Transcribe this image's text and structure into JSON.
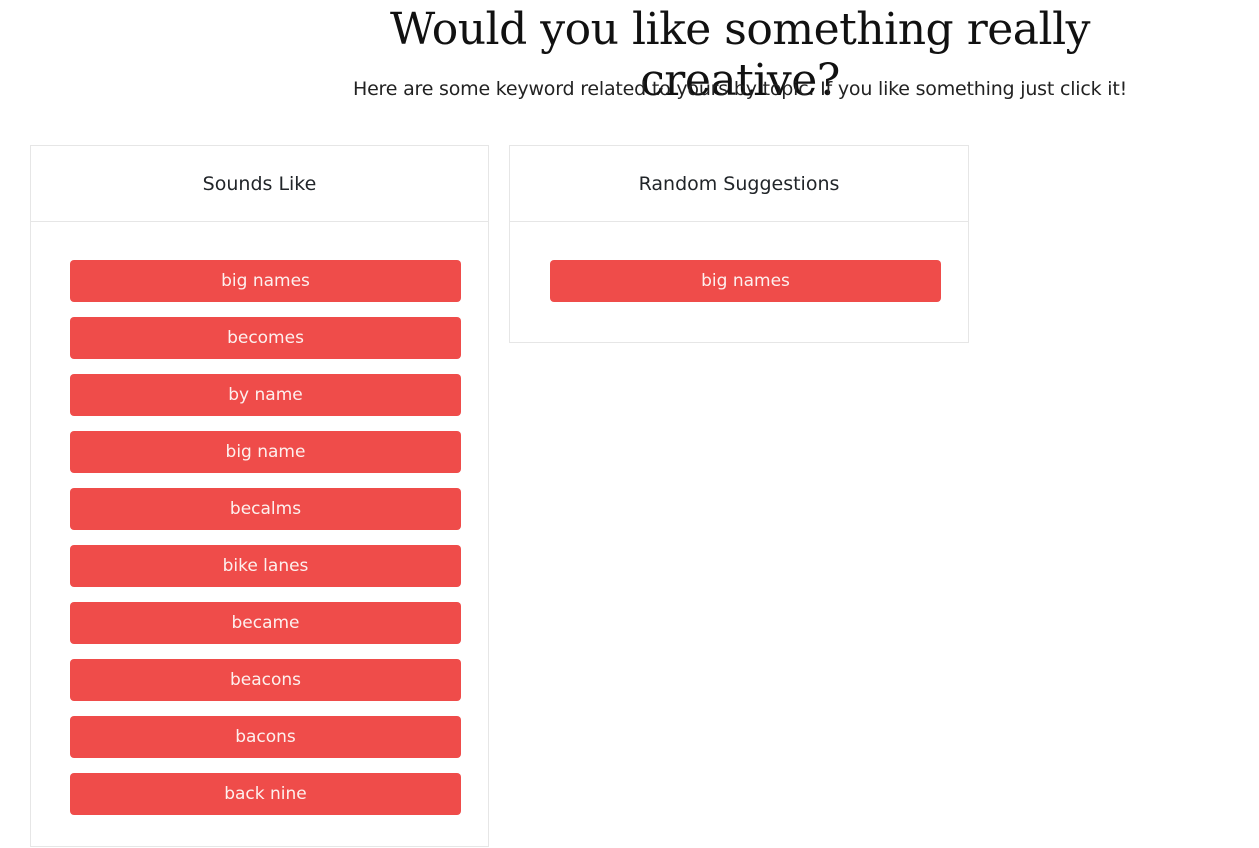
{
  "header": {
    "title": "Would you like something really creative?",
    "subtitle": "Here are some keyword related to yours by topic. If you like something just click it!"
  },
  "colors": {
    "button_bg": "#ef4c4a",
    "button_text": "#fdf0ee",
    "card_border": "#e6e6e6"
  },
  "cards": [
    {
      "title": "Sounds Like",
      "items": [
        "big names",
        "becomes",
        "by name",
        "big name",
        "becalms",
        "bike lanes",
        "became",
        "beacons",
        "bacons",
        "back nine"
      ]
    },
    {
      "title": "Random Suggestions",
      "items": [
        "big names"
      ]
    }
  ]
}
